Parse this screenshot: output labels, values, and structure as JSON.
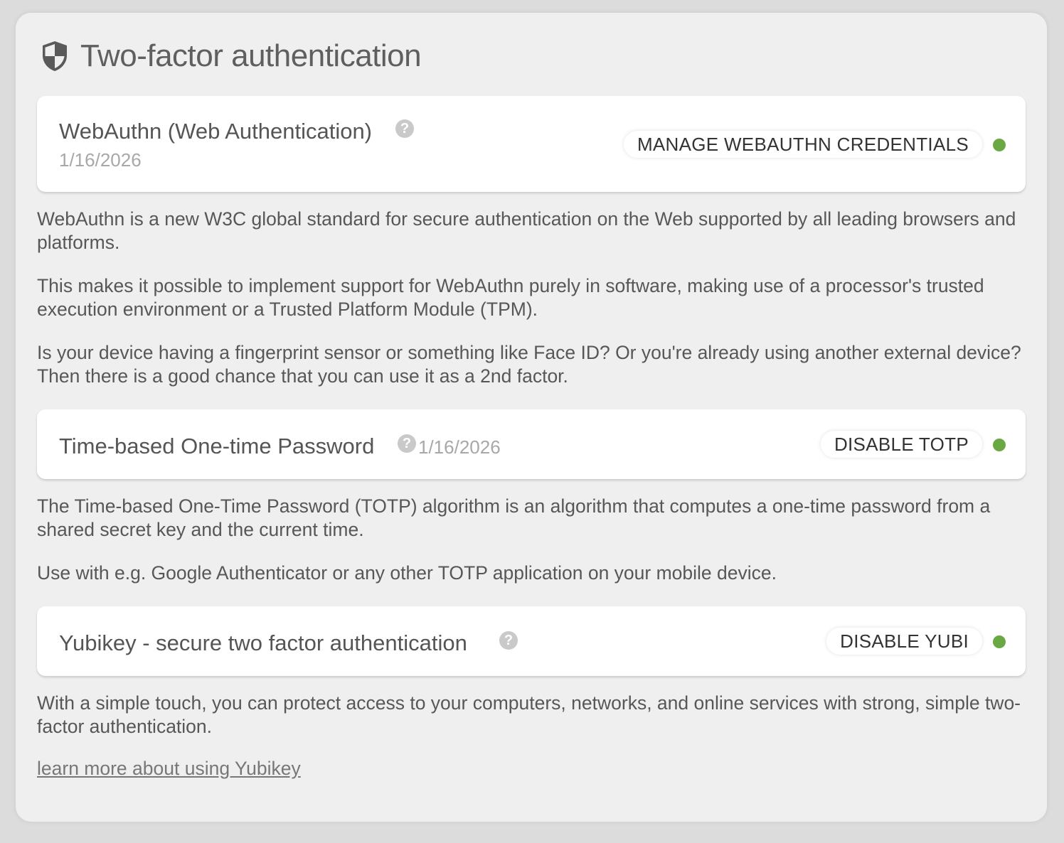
{
  "header": {
    "title": "Two-factor authentication",
    "icon": "shield-icon"
  },
  "webauthn": {
    "title": "WebAuthn (Web Authentication)",
    "date": "1/16/2026",
    "button_label": "MANAGE WEBAUTHN CREDENTIALS",
    "status_color": "#6aa844",
    "paragraphs": [
      "WebAuthn is a new W3C global standard for secure authentication on the Web supported by all leading browsers and platforms.",
      "This makes it possible to implement support for WebAuthn purely in software, making use of a processor's trusted execution environment or a Trusted Platform Module (TPM).",
      "Is your device having a fingerprint sensor or something like Face ID? Or you're already using another external device? Then there is a good chance that you can use it as a 2nd factor."
    ]
  },
  "totp": {
    "title": "Time-based One-time Password",
    "date": "1/16/2026",
    "button_label": "DISABLE TOTP",
    "status_color": "#6aa844",
    "paragraphs": [
      "The Time-based One-Time Password (TOTP) algorithm is an algorithm that computes a one-time password from a shared secret key and the current time.",
      "Use with e.g. Google Authenticator or any other TOTP application on your mobile device."
    ]
  },
  "yubikey": {
    "title": "Yubikey - secure two factor authentication",
    "button_label": "DISABLE YUBI",
    "status_color": "#6aa844",
    "paragraphs": [
      "With a simple touch, you can protect access to your computers, networks, and online services with strong, simple two-factor authentication."
    ],
    "link_label": "learn more about using Yubikey"
  },
  "help_icon_glyph": "?"
}
